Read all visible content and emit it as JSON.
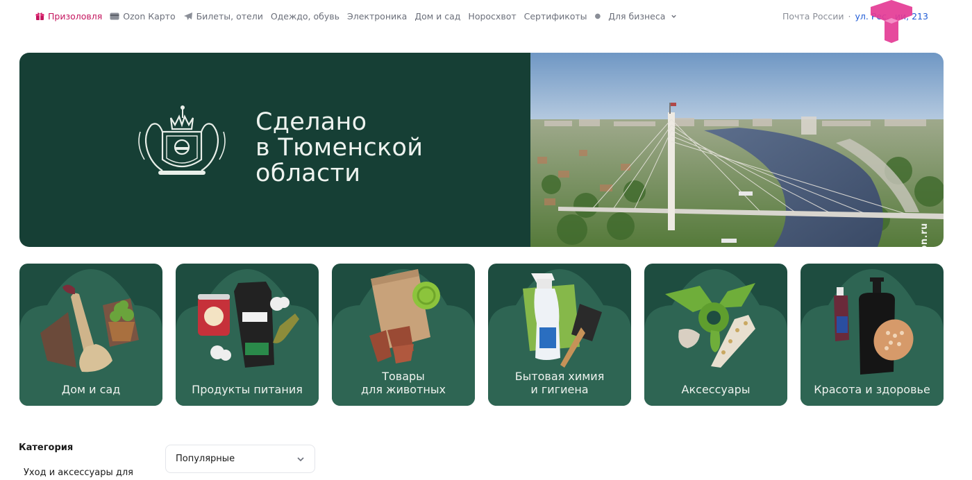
{
  "nav": {
    "items": [
      {
        "label": "Призоловля",
        "icon": "gift-icon",
        "promo": true
      },
      {
        "label": "Ozon Карто",
        "icon": "card-icon"
      },
      {
        "label": "Билеты, отели",
        "icon": "plane-icon"
      },
      {
        "label": "Одеждо, обувь"
      },
      {
        "label": "Электроника"
      },
      {
        "label": "Дом и сад"
      },
      {
        "label": "Норосхвот"
      },
      {
        "label": "Сертификоты"
      }
    ],
    "business_label": "Для бизнеса",
    "delivery_label": "Почта России",
    "address_label": "ул. Рес...ии, 213"
  },
  "hero": {
    "title_lines": [
      "Сделано",
      "в Тюменской",
      "области"
    ],
    "watermark": "ozon.ru"
  },
  "tiles": [
    {
      "label_lines": [
        "Дом и сад"
      ],
      "art": "home-garden"
    },
    {
      "label_lines": [
        "Продукты питания"
      ],
      "art": "food"
    },
    {
      "label_lines": [
        "Товары",
        "для животных"
      ],
      "art": "pets"
    },
    {
      "label_lines": [
        "Бытовая химия",
        "и гигиена"
      ],
      "art": "chemicals"
    },
    {
      "label_lines": [
        "Аксессуары"
      ],
      "art": "accessories"
    },
    {
      "label_lines": [
        "Красота и здоровье"
      ],
      "art": "beauty"
    }
  ],
  "filters": {
    "category_heading": "Категория",
    "first_category": "Уход и аксессуары для",
    "sort_value": "Популярные"
  },
  "colors": {
    "brand_dark_green": "#163f35",
    "tile_green": "#1e4d40",
    "promo_pink": "#c4155e",
    "link_blue": "#1f5bd6"
  }
}
